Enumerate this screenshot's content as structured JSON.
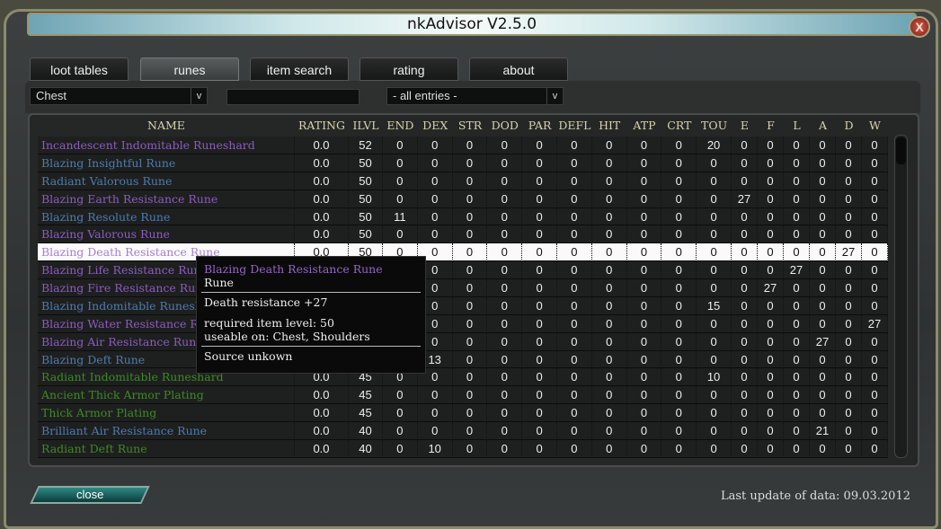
{
  "window": {
    "title": "nkAdvisor V2.5.0",
    "close_glyph": "X"
  },
  "tabs": [
    {
      "label": "loot tables"
    },
    {
      "label": "runes",
      "active": true
    },
    {
      "label": "item search"
    },
    {
      "label": "rating"
    },
    {
      "label": "about"
    }
  ],
  "filters": {
    "slot": "Chest",
    "search": "",
    "entries": "- all entries -",
    "dropdown_arrow": "v"
  },
  "columns": [
    "NAME",
    "RATING",
    "ILVL",
    "END",
    "DEX",
    "STR",
    "DOD",
    "PAR",
    "DEFL",
    "HIT",
    "ATP",
    "CRT",
    "TOU",
    "E",
    "F",
    "L",
    "A",
    "D",
    "W"
  ],
  "colors": {
    "epic": "#8b5cbf",
    "rare": "#4d7cb0",
    "uncommon": "#3d8a26"
  },
  "rows": [
    {
      "name": "Incandescent Indomitable Runeshard",
      "q": "epic",
      "v": [
        "0.0",
        "52",
        "0",
        "0",
        "0",
        "0",
        "0",
        "0",
        "0",
        "0",
        "0",
        "20",
        "0",
        "0",
        "0",
        "0",
        "0",
        "0"
      ]
    },
    {
      "name": "Blazing Insightful Rune",
      "q": "rare",
      "v": [
        "0.0",
        "50",
        "0",
        "0",
        "0",
        "0",
        "0",
        "0",
        "0",
        "0",
        "0",
        "0",
        "0",
        "0",
        "0",
        "0",
        "0",
        "0"
      ]
    },
    {
      "name": "Radiant Valorous Rune",
      "q": "rare",
      "v": [
        "0.0",
        "50",
        "0",
        "0",
        "0",
        "0",
        "0",
        "0",
        "0",
        "0",
        "0",
        "0",
        "0",
        "0",
        "0",
        "0",
        "0",
        "0"
      ]
    },
    {
      "name": "Blazing Earth Resistance Rune",
      "q": "epic",
      "v": [
        "0.0",
        "50",
        "0",
        "0",
        "0",
        "0",
        "0",
        "0",
        "0",
        "0",
        "0",
        "0",
        "27",
        "0",
        "0",
        "0",
        "0",
        "0"
      ]
    },
    {
      "name": "Blazing Resolute Rune",
      "q": "rare",
      "v": [
        "0.0",
        "50",
        "11",
        "0",
        "0",
        "0",
        "0",
        "0",
        "0",
        "0",
        "0",
        "0",
        "0",
        "0",
        "0",
        "0",
        "0",
        "0"
      ]
    },
    {
      "name": "Blazing Valorous Rune",
      "q": "epic",
      "v": [
        "0.0",
        "50",
        "0",
        "0",
        "0",
        "0",
        "0",
        "0",
        "0",
        "0",
        "0",
        "0",
        "0",
        "0",
        "0",
        "0",
        "0",
        "0"
      ]
    },
    {
      "name": "Blazing Death Resistance Rune",
      "q": "epic",
      "selected": true,
      "v": [
        "0.0",
        "50",
        "0",
        "0",
        "0",
        "0",
        "0",
        "0",
        "0",
        "0",
        "0",
        "0",
        "0",
        "0",
        "0",
        "0",
        "27",
        "0"
      ]
    },
    {
      "name": "Blazing Life Resistance Rune",
      "q": "epic",
      "v": [
        "",
        "",
        "",
        "0",
        "0",
        "0",
        "0",
        "0",
        "0",
        "0",
        "0",
        "0",
        "0",
        "0",
        "27",
        "0",
        "0",
        "0"
      ]
    },
    {
      "name": "Blazing Fire Resistance Rune",
      "q": "epic",
      "v": [
        "",
        "",
        "",
        "0",
        "0",
        "0",
        "0",
        "0",
        "0",
        "0",
        "0",
        "0",
        "0",
        "27",
        "0",
        "0",
        "0",
        "0"
      ]
    },
    {
      "name": "Blazing Indomitable Runeshard",
      "q": "rare",
      "v": [
        "",
        "",
        "",
        "0",
        "0",
        "0",
        "0",
        "0",
        "0",
        "0",
        "0",
        "15",
        "0",
        "0",
        "0",
        "0",
        "0",
        "0"
      ]
    },
    {
      "name": "Blazing Water Resistance Rune",
      "q": "epic",
      "v": [
        "",
        "",
        "",
        "0",
        "0",
        "0",
        "0",
        "0",
        "0",
        "0",
        "0",
        "0",
        "0",
        "0",
        "0",
        "0",
        "0",
        "27"
      ]
    },
    {
      "name": "Blazing Air Resistance Rune",
      "q": "epic",
      "v": [
        "",
        "",
        "",
        "0",
        "0",
        "0",
        "0",
        "0",
        "0",
        "0",
        "0",
        "0",
        "0",
        "0",
        "0",
        "27",
        "0",
        "0"
      ]
    },
    {
      "name": "Blazing Deft Rune",
      "q": "rare",
      "v": [
        "",
        "",
        "",
        "13",
        "0",
        "0",
        "0",
        "0",
        "0",
        "0",
        "0",
        "0",
        "0",
        "0",
        "0",
        "0",
        "0",
        "0"
      ]
    },
    {
      "name": "Radiant Indomitable Runeshard",
      "q": "uncommon",
      "v": [
        "0.0",
        "45",
        "0",
        "0",
        "0",
        "0",
        "0",
        "0",
        "0",
        "0",
        "0",
        "10",
        "0",
        "0",
        "0",
        "0",
        "0",
        "0"
      ]
    },
    {
      "name": "Ancient Thick Armor Plating",
      "q": "uncommon",
      "v": [
        "0.0",
        "45",
        "0",
        "0",
        "0",
        "0",
        "0",
        "0",
        "0",
        "0",
        "0",
        "0",
        "0",
        "0",
        "0",
        "0",
        "0",
        "0"
      ]
    },
    {
      "name": "Thick Armor Plating",
      "q": "uncommon",
      "v": [
        "0.0",
        "45",
        "0",
        "0",
        "0",
        "0",
        "0",
        "0",
        "0",
        "0",
        "0",
        "0",
        "0",
        "0",
        "0",
        "0",
        "0",
        "0"
      ]
    },
    {
      "name": "Brilliant Air Resistance Rune",
      "q": "rare",
      "v": [
        "0.0",
        "40",
        "0",
        "0",
        "0",
        "0",
        "0",
        "0",
        "0",
        "0",
        "0",
        "0",
        "0",
        "0",
        "0",
        "21",
        "0",
        "0"
      ]
    },
    {
      "name": "Radiant Deft Rune",
      "q": "uncommon",
      "v": [
        "0.0",
        "40",
        "0",
        "10",
        "0",
        "0",
        "0",
        "0",
        "0",
        "0",
        "0",
        "0",
        "0",
        "0",
        "0",
        "0",
        "0",
        "0"
      ]
    }
  ],
  "tooltip": {
    "title": "Blazing Death Resistance Rune",
    "type": "Rune",
    "stat": "Death resistance +27",
    "req": "required item level: 50",
    "useable": "useable on: Chest, Shoulders",
    "source": "Source unkown"
  },
  "footer": {
    "close": "close",
    "last_update": "Last update of data: 09.03.2012"
  }
}
